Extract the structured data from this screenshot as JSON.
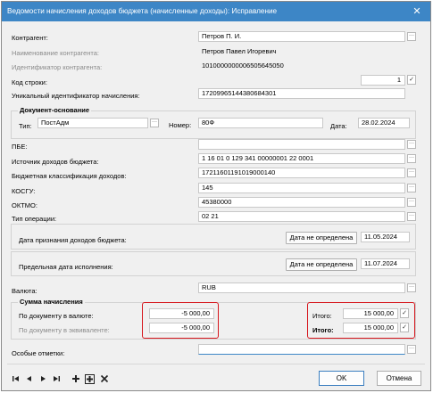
{
  "window": {
    "title": "Ведомости начисления доходов бюджета (начисленные доходы): Исправление",
    "close_glyph": "✕"
  },
  "form": {
    "kontragent": {
      "label": "Контрагент:",
      "value": "Петров П. И."
    },
    "naim_kontragenta": {
      "label": "Наименование контрагента:",
      "value": "Петров Павел Игоревич"
    },
    "ident_kontragenta": {
      "label": "Идентификатор контрагента:",
      "value": "1010000000006505645050"
    },
    "kod_stroki": {
      "label": "Код строки:",
      "value": "1"
    },
    "uin": {
      "label": "Уникальный идентификатор начисления:",
      "value": "17209965144380684301"
    },
    "document_osnovanie": {
      "legend": "Документ-основание",
      "tip_label": "Тип:",
      "tip_value": "ПостАдм",
      "nomer_label": "Номер:",
      "nomer_value": "80Ф",
      "data_label": "Дата:",
      "data_value": "28.02.2024"
    },
    "pbe": {
      "label": "ПБЕ:",
      "value": ""
    },
    "istochnik": {
      "label": "Источник доходов бюджета:",
      "value": "1 16 01 0 129 341 00000001 22 0001"
    },
    "bk": {
      "label": "Бюджетная классификация доходов:",
      "value": "17211601191019000140"
    },
    "kosgu": {
      "label": "КОСГУ:",
      "value": "145"
    },
    "oktmo": {
      "label": "ОКТМО:",
      "value": "45380000"
    },
    "tip_operacii": {
      "label": "Тип операции:",
      "value": "02 21"
    },
    "data_priznaniya": {
      "label": "Дата признания доходов бюджета:",
      "button": "Дата не определена",
      "value": "11.05.2024"
    },
    "predelnaya_data": {
      "label": "Предельная дата исполнения:",
      "button": "Дата не определена",
      "value": "11.07.2024"
    },
    "valuta": {
      "label": "Валюта:",
      "value": "RUB"
    },
    "summa": {
      "legend": "Сумма начисления",
      "po_doc_val_label": "По документу в валюте:",
      "po_doc_val_value": "-5 000,00",
      "po_doc_ekv_label": "По документу в эквиваленте:",
      "po_doc_ekv_value": "-5 000,00",
      "itogo1_label": "Итого:",
      "itogo1_value": "15 000,00",
      "itogo2_label": "Итого:",
      "itogo2_value": "15 000,00"
    },
    "osobye": {
      "label": "Особые отметки:",
      "value": ""
    }
  },
  "buttons": {
    "ellipsis": "···",
    "check": "✓",
    "ok": "OK",
    "cancel": "Отмена"
  },
  "nav_icons": [
    "first-icon",
    "prev-icon",
    "next-icon",
    "last-icon",
    "add-icon",
    "add-copy-icon",
    "delete-icon"
  ],
  "colors": {
    "title_bar": "#3d86c6",
    "highlight": "#d6151c",
    "ok_border": "#3c7fc0"
  }
}
